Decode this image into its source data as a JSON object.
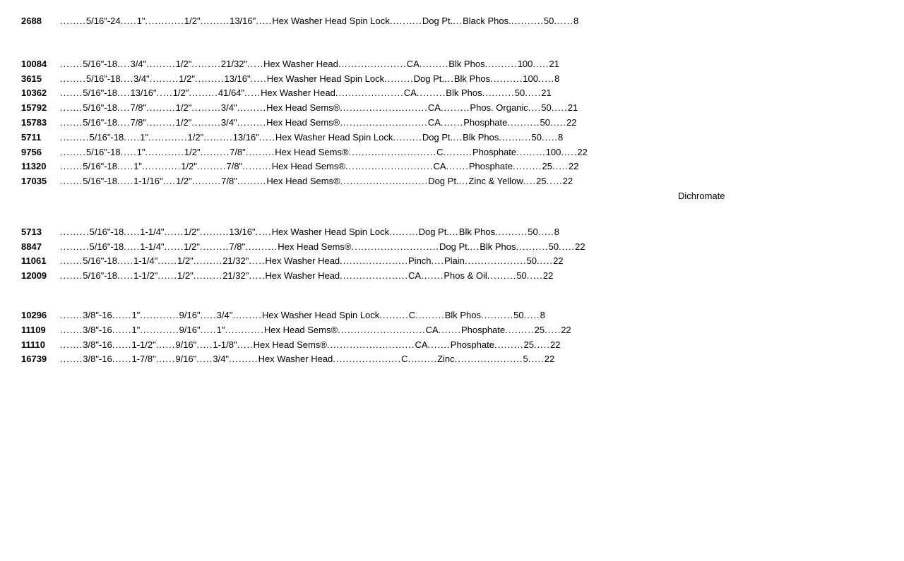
{
  "rows": [
    {
      "id": "top_section",
      "items": [
        {
          "partNum": "2688",
          "thread": "5/16\"-24",
          "length": "1\"",
          "driver": "1/2\"",
          "od": "13/16\"",
          "head": "Hex Washer Head Spin Lock",
          "point": "Dog Pt.",
          "finish": "Black Phos.",
          "qty": "50",
          "num2": "8"
        }
      ]
    },
    {
      "id": "section2",
      "items": [
        {
          "partNum": "10084",
          "thread": "5/16\"-18",
          "length": "3/4\"",
          "driver": "1/2\"",
          "od": "21/32\"",
          "head": "Hex Washer Head",
          "point": "CA",
          "finish": "Blk Phos",
          "qty": "100",
          "num2": "21"
        },
        {
          "partNum": "3615",
          "thread": "5/16\"-18",
          "length": "3/4\"",
          "driver": "1/2\"",
          "od": "13/16\"",
          "head": "Hex Washer Head Spin Lock",
          "point": "Dog Pt.",
          "finish": "Blk Phos",
          "qty": "100",
          "num2": "8"
        },
        {
          "partNum": "10362",
          "thread": "5/16\"-18",
          "length": "13/16\"",
          "driver": "1/2\"",
          "od": "41/64\"",
          "head": "Hex Washer Head",
          "point": "CA",
          "finish": "Blk Phos",
          "qty": "50",
          "num2": "21"
        },
        {
          "partNum": "15792",
          "thread": "5/16\"-18",
          "length": "7/8\"",
          "driver": "1/2\"",
          "od": "3/4\"",
          "head": "Hex Head Sems®",
          "point": "CA",
          "finish": "Phos. Organic",
          "qty": "50",
          "num2": "21"
        },
        {
          "partNum": "15783",
          "thread": "5/16\"-18",
          "length": "7/8\"",
          "driver": "1/2\"",
          "od": "3/4\"",
          "head": "Hex Head Sems®",
          "point": "CA",
          "finish": "Phosphate",
          "qty": "50",
          "num2": "22"
        },
        {
          "partNum": "5711",
          "thread": "5/16\"-18",
          "length": "1\"",
          "driver": "1/2\"",
          "od": "13/16\"",
          "head": "Hex Washer Head Spin Lock",
          "point": "Dog Pt.",
          "finish": "Blk Phos",
          "qty": "50",
          "num2": "8"
        },
        {
          "partNum": "9756",
          "thread": "5/16\"-18",
          "length": "1\"",
          "driver": "1/2\"",
          "od": "7/8\"",
          "head": "Hex Head Sems®",
          "point": "C",
          "finish": "Phosphate",
          "qty": "100",
          "num2": "22"
        },
        {
          "partNum": "11320",
          "thread": "5/16\"-18",
          "length": "1\"",
          "driver": "1/2\"",
          "od": "7/8\"",
          "head": "Hex Head Sems®",
          "point": "CA",
          "finish": "Phosphate",
          "qty": "25",
          "num2": "22"
        },
        {
          "partNum": "17035",
          "thread": "5/16\"-18",
          "length": "1-1/16\"",
          "driver": "1/2\"",
          "od": "7/8\"",
          "head": "Hex Head Sems®",
          "point": "Dog Pt.",
          "finish": "Zinc & Yellow",
          "qty": "25",
          "num2": "22",
          "finishLine2": "Dichromate"
        }
      ]
    },
    {
      "id": "section3",
      "items": [
        {
          "partNum": "5713",
          "thread": "5/16\"-18",
          "length": "1-1/4\"",
          "driver": "1/2\"",
          "od": "13/16\"",
          "head": "Hex Washer Head Spin Lock",
          "point": "Dog Pt.",
          "finish": "Blk Phos",
          "qty": "50",
          "num2": "8"
        },
        {
          "partNum": "8847",
          "thread": "5/16\"-18",
          "length": "1-1/4\"",
          "driver": "1/2\"",
          "od": "7/8\"",
          "head": "Hex Head Sems®",
          "point": "Dog Pt.",
          "finish": "Blk Phos",
          "qty": "50",
          "num2": "22"
        },
        {
          "partNum": "11061",
          "thread": "5/16\"-18",
          "length": "1-1/4\"",
          "driver": "1/2\"",
          "od": "21/32\"",
          "head": "Hex Washer Head",
          "point": "Pinch",
          "finish": "Plain",
          "qty": "50",
          "num2": "22"
        },
        {
          "partNum": "12009",
          "thread": "5/16\"-18",
          "length": "1-1/2\"",
          "driver": "1/2\"",
          "od": "21/32\"",
          "head": "Hex Washer Head",
          "point": "CA",
          "finish": "Phos & Oil",
          "qty": "50",
          "num2": "22"
        }
      ]
    },
    {
      "id": "section4",
      "items": [
        {
          "partNum": "10296",
          "thread": "3/8\"-16",
          "length": "1\"",
          "driver": "9/16\"",
          "od": "3/4\"",
          "head": "Hex Washer Head Spin Lock",
          "point": "C",
          "finish": "Blk Phos",
          "qty": "50",
          "num2": "8"
        },
        {
          "partNum": "11109",
          "thread": "3/8\"-16",
          "length": "1\"",
          "driver": "9/16\"",
          "od": "1\"",
          "head": "Hex Head Sems®",
          "point": "CA",
          "finish": "Phosphate",
          "qty": "25",
          "num2": "22"
        },
        {
          "partNum": "11110",
          "thread": "3/8\"-16",
          "length": "1-1/2\"",
          "driver": "9/16\"",
          "od": "1-1/8\"",
          "head": "Hex Head Sems®",
          "point": "CA",
          "finish": "Phosphate",
          "qty": "25",
          "num2": "22"
        },
        {
          "partNum": "16739",
          "thread": "3/8\"-16",
          "length": "1-7/8\"",
          "driver": "9/16\"",
          "od": "3/4\"",
          "head": "Hex Washer Head",
          "point": "C",
          "finish": "Zinc",
          "qty": "5",
          "num2": "22"
        }
      ]
    }
  ],
  "dots": {
    "short": "........",
    "medium": "................",
    "long": "............................",
    "xlong": "........................................"
  }
}
